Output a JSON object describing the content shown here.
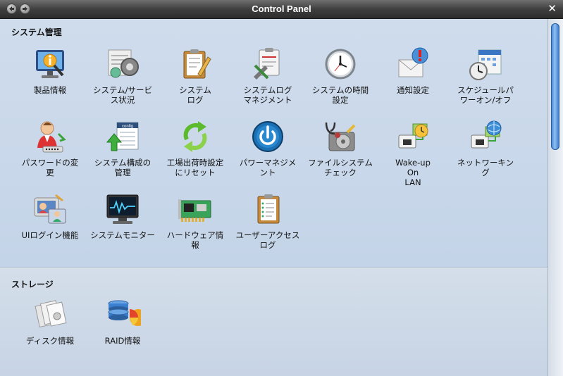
{
  "window": {
    "title": "Control Panel",
    "close_glyph": "✕"
  },
  "sections": [
    {
      "title": "システム管理",
      "items": [
        {
          "label": "製品情報",
          "icon": "product-info-icon"
        },
        {
          "label": "システム/サービ\nス状況",
          "icon": "system-service-status-icon"
        },
        {
          "label": "システム\nログ",
          "icon": "system-log-icon"
        },
        {
          "label": "システムログ\nマネジメント",
          "icon": "system-log-management-icon"
        },
        {
          "label": "システムの時間\n設定",
          "icon": "clock-icon"
        },
        {
          "label": "通知設定",
          "icon": "notification-icon"
        },
        {
          "label": "スケジュールパ\nワーオン/オフ",
          "icon": "schedule-power-icon"
        },
        {
          "label": "パスワードの変\n更",
          "icon": "password-change-icon"
        },
        {
          "label": "システム構成の\n管理",
          "icon": "config-management-icon"
        },
        {
          "label": "工場出荷時設定\nにリセット",
          "icon": "factory-reset-icon"
        },
        {
          "label": "パワーマネジメ\nント",
          "icon": "power-icon"
        },
        {
          "label": "ファイルシステム\nチェック",
          "icon": "filesystem-check-icon"
        },
        {
          "label": "Wake-up\nOn\nLAN",
          "icon": "wake-on-lan-icon"
        },
        {
          "label": "ネットワーキン\nグ",
          "icon": "networking-icon"
        },
        {
          "label": "UIログイン機能",
          "icon": "ui-login-icon"
        },
        {
          "label": "システムモニター",
          "icon": "system-monitor-icon"
        },
        {
          "label": "ハードウェア情\n報",
          "icon": "hardware-info-icon"
        },
        {
          "label": "ユーザーアクセス\nログ",
          "icon": "user-access-log-icon"
        }
      ]
    },
    {
      "title": "ストレージ",
      "items": [
        {
          "label": "ディスク情報",
          "icon": "disk-info-icon"
        },
        {
          "label": "RAID情報",
          "icon": "raid-info-icon"
        }
      ]
    }
  ]
}
